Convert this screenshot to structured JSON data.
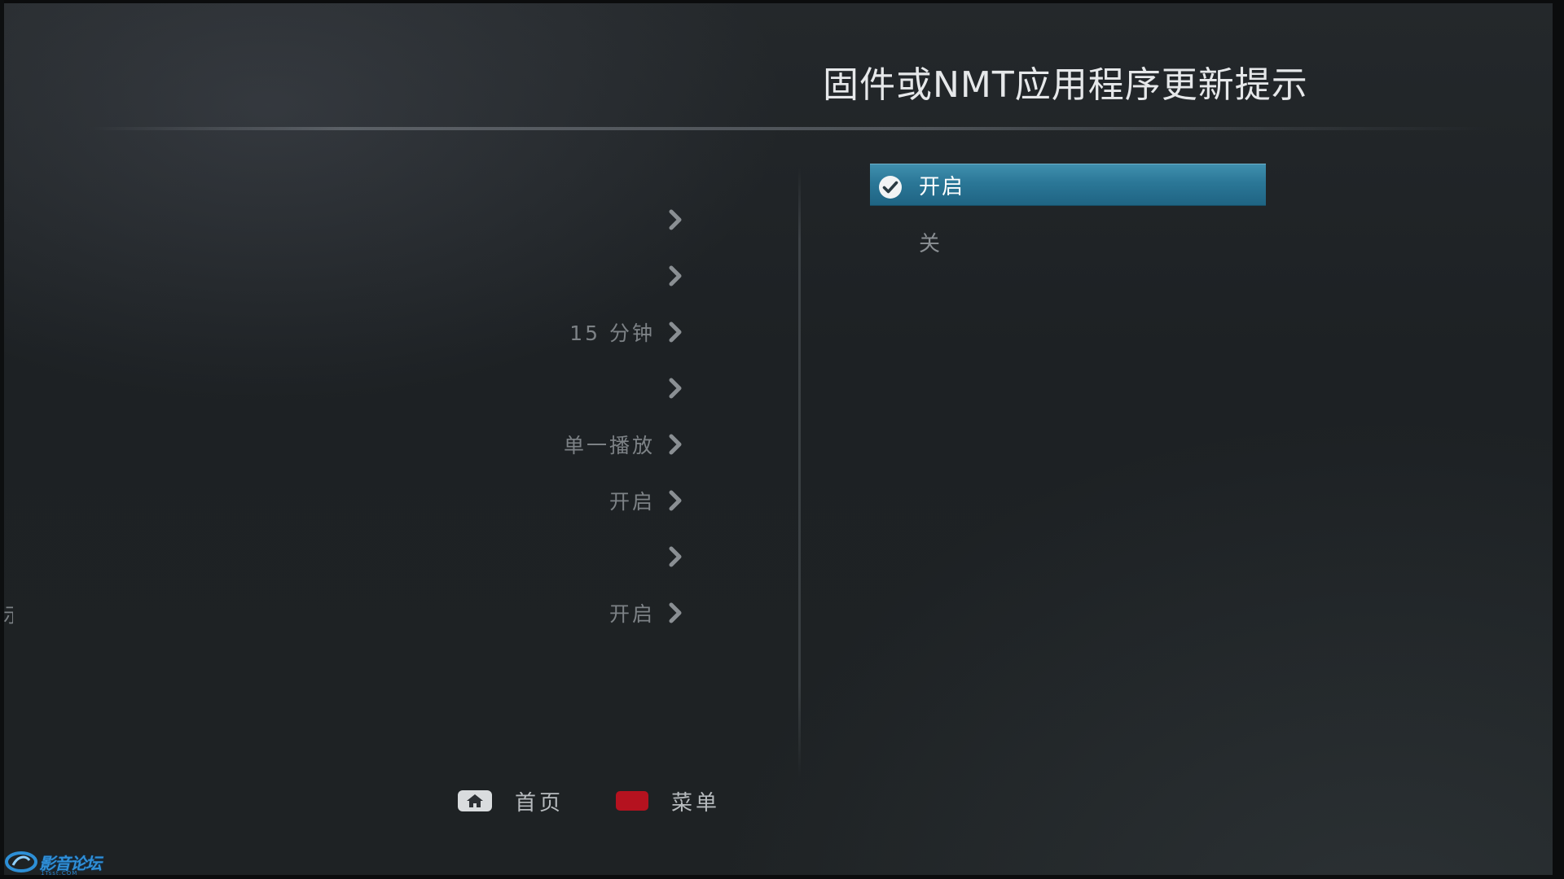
{
  "header": {
    "title": "固件或NMT应用程序更新提示"
  },
  "settings": {
    "values": [
      "",
      "",
      "15 分钟",
      "",
      "单一播放",
      "开启",
      "",
      "开启"
    ]
  },
  "options": {
    "items": [
      {
        "label": "开启",
        "selected": true
      },
      {
        "label": "关",
        "selected": false
      }
    ],
    "highlight_color": "#2b7797"
  },
  "footer": {
    "home_label": "首页",
    "menu_label": "菜单",
    "menu_key_color": "#b5121f"
  },
  "edge_text": "示",
  "watermark": {
    "text": "影音论坛",
    "sub": "1Tsst.COM"
  }
}
